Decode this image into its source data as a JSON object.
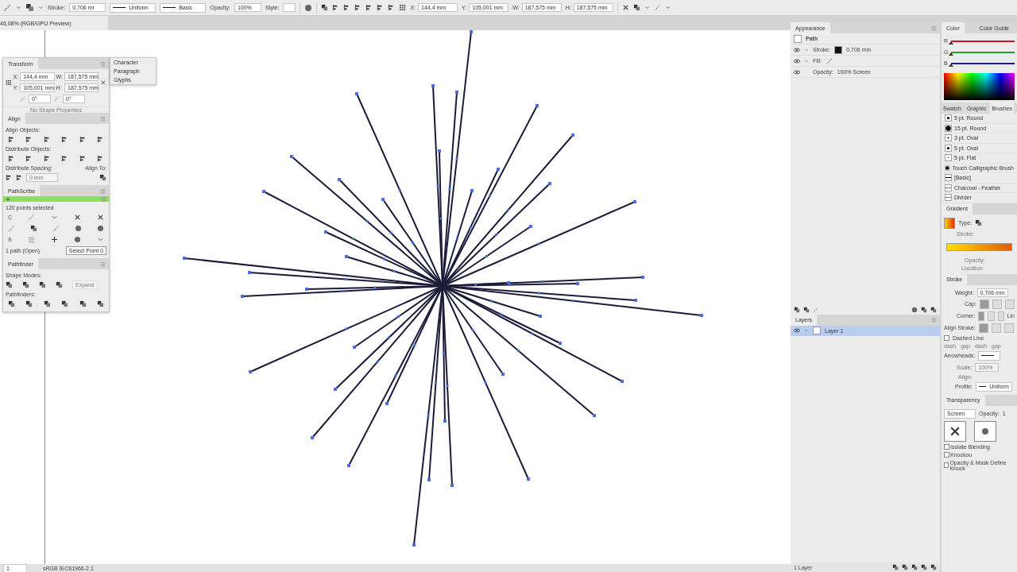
{
  "control_bar": {
    "stroke_label": "Stroke:",
    "stroke_weight": "0,706 mr",
    "profile": "Uniform",
    "brush": "Basic",
    "opacity_label": "Opacity:",
    "opacity": "100%",
    "style_label": "Style:",
    "fields": [
      {
        "label": "X:",
        "value": "144,4 mm"
      },
      {
        "label": "Y:",
        "value": "105,001 mm"
      },
      {
        "label": "W:",
        "value": "187,575 mm"
      },
      {
        "label": "H:",
        "value": "187,575 mm"
      }
    ]
  },
  "document_tab": {
    "title": "46,08% (RGB/GPU Preview)",
    "selected": true
  },
  "transform_panel": {
    "title": "Transform",
    "fields": [
      {
        "label": "X:",
        "value": "144,4 mm"
      },
      {
        "label": "W:",
        "value": "187,575 mm"
      },
      {
        "label": "Y:",
        "value": "105,001 mm"
      },
      {
        "label": "H:",
        "value": "187,575 mm"
      }
    ],
    "angle": "0°",
    "shear": "0°",
    "empty_note": "No Shape Properties"
  },
  "type_panel": {
    "items": [
      "Character",
      "Paragraph",
      "Glyphs"
    ]
  },
  "align_panel": {
    "title": "Align",
    "align_objects": "Align Objects:",
    "distribute_objects": "Distribute Objects:",
    "distribute_spacing": "Distribute Spacing:",
    "spacing_value": "0 mm",
    "align_to": "Align To:"
  },
  "pathscribe_panel": {
    "title": "PathScribe",
    "status": "120 points selected",
    "tool_letters": [
      "C",
      "S"
    ],
    "path_info": "1 path (Open)",
    "select_button": "Select Point 0"
  },
  "pathfinder_panel": {
    "title": "Pathfinder",
    "shape_modes": "Shape Modes:",
    "expand": {
      "label": "Expand",
      "disabled": true
    },
    "pathfinders": "Pathfinders:"
  },
  "appearance_panel": {
    "title": "Appearance",
    "object": "Path",
    "rows": [
      {
        "label": "Stroke:",
        "value": "0,706 mm",
        "kind": "stroke"
      },
      {
        "label": "Fill:",
        "kind": "fill"
      },
      {
        "label": "Opacity:",
        "value": "100% Screen",
        "kind": "plain"
      }
    ]
  },
  "layers_panel": {
    "title": "Layers",
    "layers": [
      {
        "name": "Layer 1",
        "selected": true
      }
    ],
    "footer": "1 Layer"
  },
  "color_panel": {
    "tabs": [
      {
        "label": "Color",
        "selected": true
      },
      {
        "label": "Color Guide",
        "selected": false
      }
    ],
    "sliders": [
      {
        "label": "R",
        "color": "#d0141e",
        "level": 0
      },
      {
        "label": "G",
        "color": "#2aa02a",
        "level": 0
      },
      {
        "label": "B",
        "color": "#1a1aa0",
        "level": 0
      }
    ]
  },
  "brushes_panel": {
    "tabs": [
      {
        "label": "Swatch",
        "selected": false
      },
      {
        "label": "Graphic",
        "selected": false
      },
      {
        "label": "Brushes",
        "selected": true
      }
    ],
    "brushes": [
      {
        "name": "5 pt. Round",
        "kind": "dot"
      },
      {
        "name": "15 pt. Round",
        "kind": "bigdot"
      },
      {
        "name": "3 pt. Oval",
        "kind": "smalldot"
      },
      {
        "name": "5 pt. Oval",
        "kind": "dot"
      },
      {
        "name": "5 pt. Flat",
        "kind": "flat"
      },
      {
        "name": "Touch Calligraphic Brush",
        "kind": "bigdot"
      },
      {
        "name": "[Basic]",
        "kind": "line"
      },
      {
        "name": "Charcoal - Feather",
        "kind": "thinline"
      },
      {
        "name": "Divider",
        "kind": "thinline"
      }
    ]
  },
  "gradient_panel": {
    "title": "Gradient",
    "type_label": "Type:",
    "stroke_label": "Stroke:",
    "opacity_label": "Opacity:",
    "location_label": "Location:"
  },
  "stroke_panel": {
    "title": "Stroke",
    "weight_label": "Weight:",
    "weight": "0,706 mm",
    "cap_label": "Cap:",
    "caps": [
      {
        "selected": true
      },
      {
        "selected": false
      },
      {
        "selected": false
      }
    ],
    "corner_label": "Corner:",
    "corners": [
      {
        "selected": true
      },
      {
        "selected": false
      },
      {
        "selected": false
      }
    ],
    "limit_label": "Lin",
    "align_label": "Align Stroke:",
    "aligns": [
      {
        "selected": true
      },
      {
        "selected": false
      },
      {
        "selected": false
      }
    ],
    "dashed": {
      "label": "Dashed Line",
      "checked": false
    },
    "dash_labels": [
      "dash",
      "gap",
      "dash",
      "gap"
    ],
    "arrowheads_label": "Arrowheads:",
    "scale_label": "Scale:",
    "scale": "100%",
    "align2_label": "Align:",
    "profile_label": "Profile:",
    "profile": "Uniform"
  },
  "transparency_panel": {
    "title": "Transparency",
    "mode": "Screen",
    "opacity_label": "Opacity:",
    "opacity": "1",
    "options": [
      {
        "label": "Isolate Blending",
        "checked": false
      },
      {
        "label": "Knockou",
        "checked": false
      }
    ],
    "mask_option": {
      "label": "Opacity & Mask Define Knock",
      "checked": false
    }
  },
  "status_bar": {
    "zoom": "1",
    "profile": "sRGB IEC61966-2.1"
  }
}
